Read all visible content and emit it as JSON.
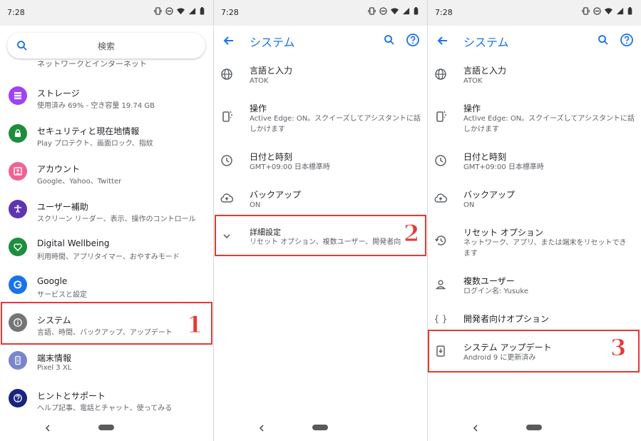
{
  "status": {
    "time": "7:28"
  },
  "screen1": {
    "search_placeholder": "検索",
    "partial_top_text": "ネットワークとインターネット",
    "items": [
      {
        "icon": "storage-icon",
        "title": "ストレージ",
        "subtitle": "使用済み 69% - 空き容量 19.74 GB",
        "color": "#a142f4"
      },
      {
        "icon": "security-icon",
        "title": "セキュリティと現在地情報",
        "subtitle": "Play プロテクト、画面ロック、指紋",
        "color": "#1e8e3e"
      },
      {
        "icon": "account-icon",
        "title": "アカウント",
        "subtitle": "Google、Yahoo、Twitter",
        "color": "#f06292"
      },
      {
        "icon": "accessibility-icon",
        "title": "ユーザー補助",
        "subtitle": "スクリーン リーダー、表示、操作のコントロール",
        "color": "#5e35b1"
      },
      {
        "icon": "wellbeing-icon",
        "title": "Digital Wellbeing",
        "subtitle": "利用時間、アプリタイマー、おやすみモード",
        "color": "#1e8e3e"
      },
      {
        "icon": "google-icon",
        "title": "Google",
        "subtitle": "サービスと設定",
        "color": "#1a73e8"
      },
      {
        "icon": "info-icon",
        "title": "システム",
        "subtitle": "言語、時間、バックアップ、アップデート",
        "color": "#757575"
      },
      {
        "icon": "phone-info-icon",
        "title": "端末情報",
        "subtitle": "Pixel 3 XL",
        "color": "#7986cb"
      },
      {
        "icon": "help-icon",
        "title": "ヒントとサポート",
        "subtitle": "ヘルプ記事、電話とチャット、使ってみる",
        "color": "#1a237e"
      }
    ],
    "step_label": "1"
  },
  "screen2": {
    "title": "システム",
    "items": [
      {
        "icon": "globe-icon",
        "title": "言語と入力",
        "subtitle": "ATOK"
      },
      {
        "icon": "gesture-icon",
        "title": "操作",
        "subtitle": "Active Edge: ON。スクイーズしてアシスタントに話",
        "subtitle2": "しかけます"
      },
      {
        "icon": "clock-icon",
        "title": "日付と時刻",
        "subtitle": "GMT+09:00 日本標準時"
      },
      {
        "icon": "backup-icon",
        "title": "バックアップ",
        "subtitle": "ON"
      },
      {
        "icon": "chevron-down-icon",
        "title": "詳細設定",
        "subtitle": "リセット オプション、複数ユーザー、開発者向"
      }
    ],
    "step_label": "2"
  },
  "screen3": {
    "title": "システム",
    "items": [
      {
        "icon": "globe-icon",
        "title": "言語と入力",
        "subtitle": "ATOK"
      },
      {
        "icon": "gesture-icon",
        "title": "操作",
        "subtitle": "Active Edge: ON。スクイーズしてアシスタントに話",
        "subtitle2": "しかけます"
      },
      {
        "icon": "clock-icon",
        "title": "日付と時刻",
        "subtitle": "GMT+09:00 日本標準時"
      },
      {
        "icon": "backup-icon",
        "title": "バックアップ",
        "subtitle": "ON"
      },
      {
        "icon": "history-icon",
        "title": "リセット オプション",
        "subtitle": "ネットワーク、アプリ、または端末をリセットでき",
        "subtitle2": "ます"
      },
      {
        "icon": "person-icon",
        "title": "複数ユーザー",
        "subtitle": "ログイン名: Yusuke"
      },
      {
        "icon": "code-icon",
        "title": "開発者向けオプション"
      },
      {
        "icon": "system-update-icon",
        "title": "システム アップデート",
        "subtitle": "Android 9 に更新済み"
      }
    ],
    "step_label": "3"
  }
}
